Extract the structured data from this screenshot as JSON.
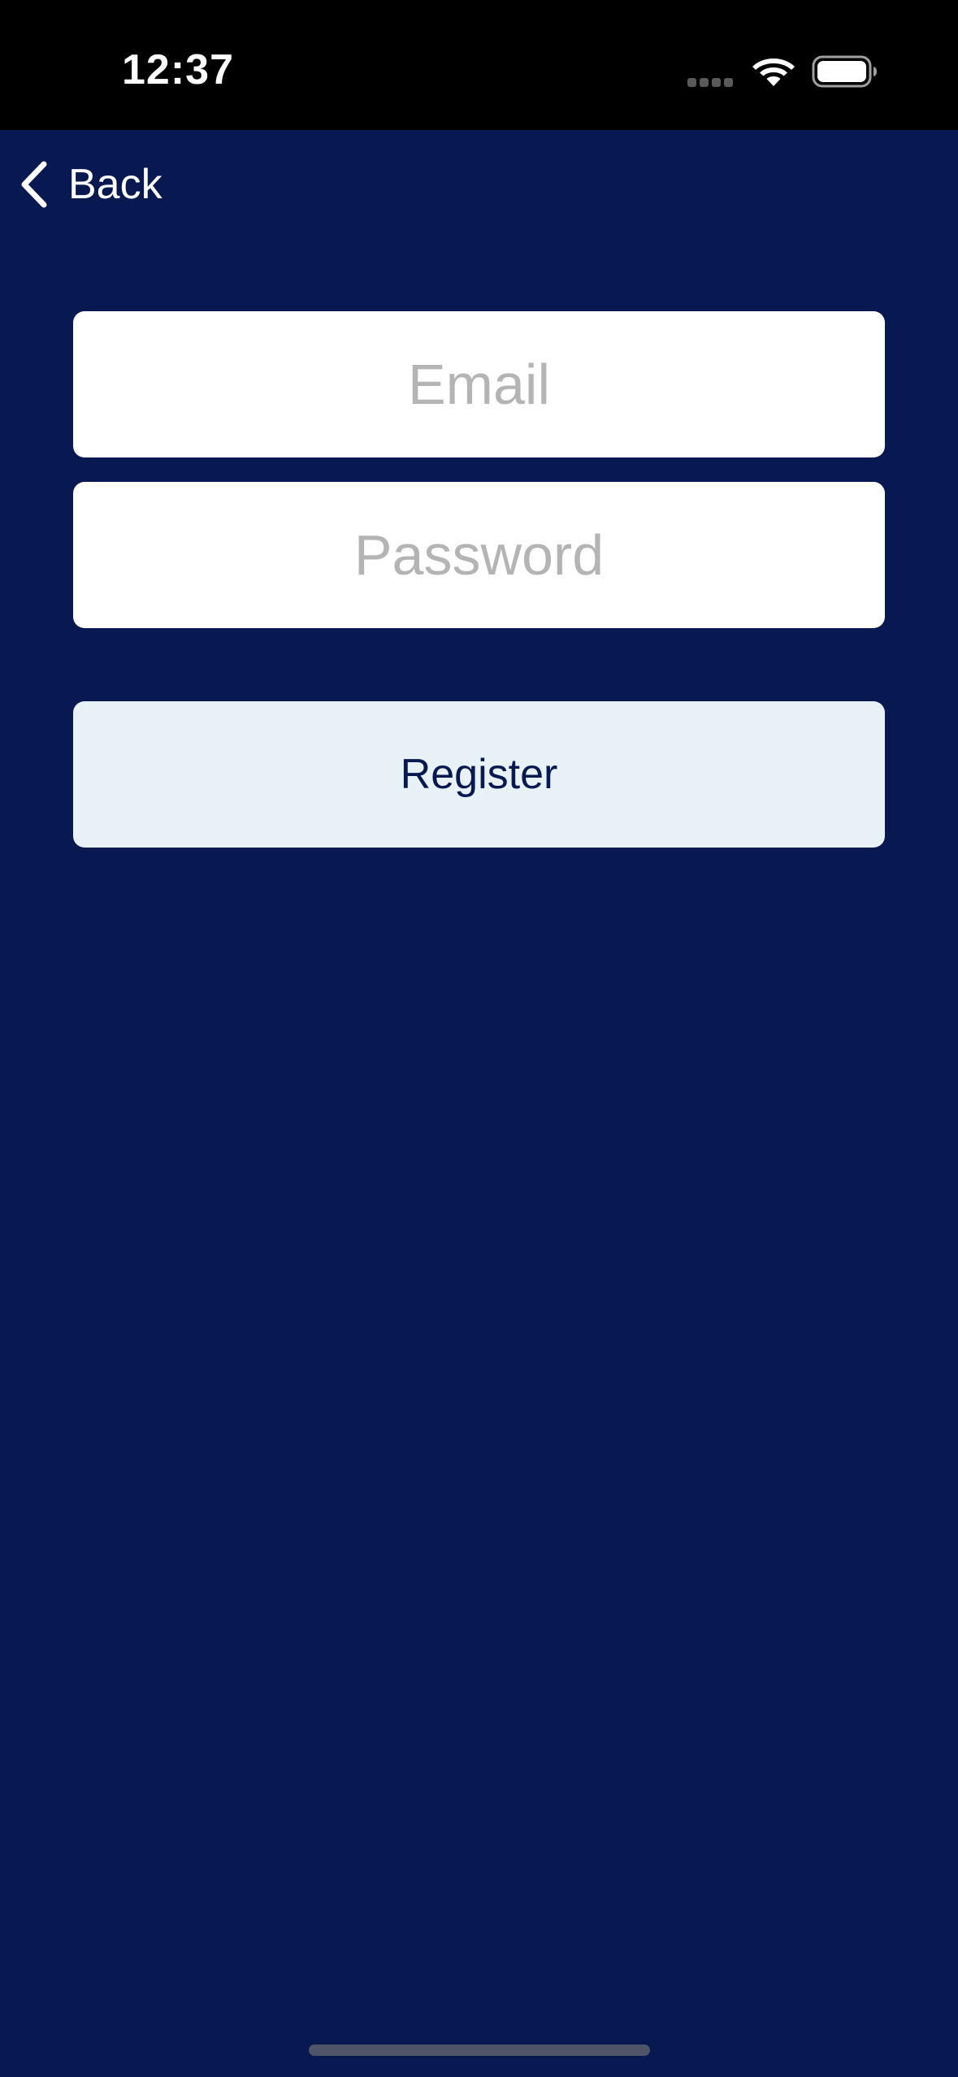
{
  "status_bar": {
    "time": "12:37",
    "icons": [
      "signal-dots-icon",
      "wifi-icon",
      "battery-icon"
    ]
  },
  "nav": {
    "back_label": "Back",
    "back_icon": "chevron-left-icon"
  },
  "form": {
    "email_placeholder": "Email",
    "email_value": "",
    "password_placeholder": "Password",
    "password_value": "",
    "register_label": "Register"
  },
  "colors": {
    "background": "#081850",
    "status_bar": "#000000",
    "field_background": "#ffffff",
    "placeholder": "#b4b4b4",
    "button_background": "#e8f2f6",
    "button_text": "#081850"
  }
}
